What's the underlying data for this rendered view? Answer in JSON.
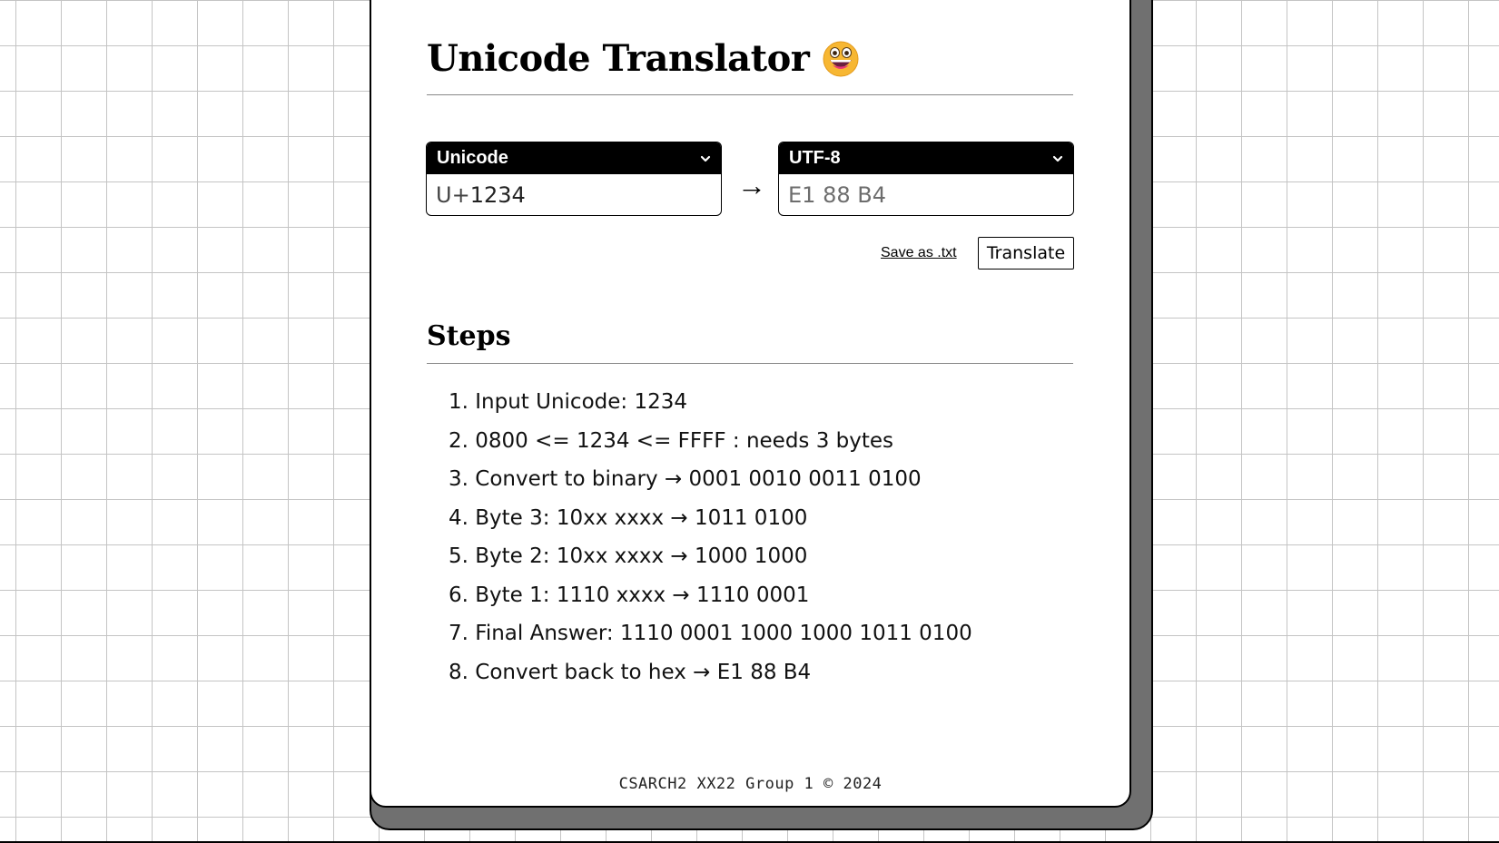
{
  "header": {
    "title": "Unicode Translator"
  },
  "converter": {
    "source": {
      "format": "Unicode",
      "prefix": "U+",
      "value": "1234"
    },
    "arrow": "→",
    "target": {
      "format": "UTF-8",
      "value": "E1 88 B4"
    }
  },
  "actions": {
    "save_label": "Save as .txt",
    "translate_label": "Translate"
  },
  "steps": {
    "title": "Steps",
    "items": [
      "Input Unicode: 1234",
      "0800 <= 1234 <= FFFF : needs 3 bytes",
      "Convert to binary → 0001 0010 0011 0100",
      "Byte 3: 10xx xxxx → 1011 0100",
      "Byte 2: 10xx xxxx → 1000 1000",
      "Byte 1: 1110 xxxx → 1110 0001",
      "Final Answer: 1110 0001 1000 1000 1011 0100",
      "Convert back to hex → E1 88 B4"
    ]
  },
  "footer": {
    "text": "CSARCH2 XX22 Group 1 © 2024"
  },
  "icons": {
    "title_emoji": "grinning-face-icon",
    "dropdown": "chevron-down-icon"
  },
  "colors": {
    "shadow": "#707070",
    "select_bar": "#000000",
    "grid": "#c4c4c4"
  }
}
